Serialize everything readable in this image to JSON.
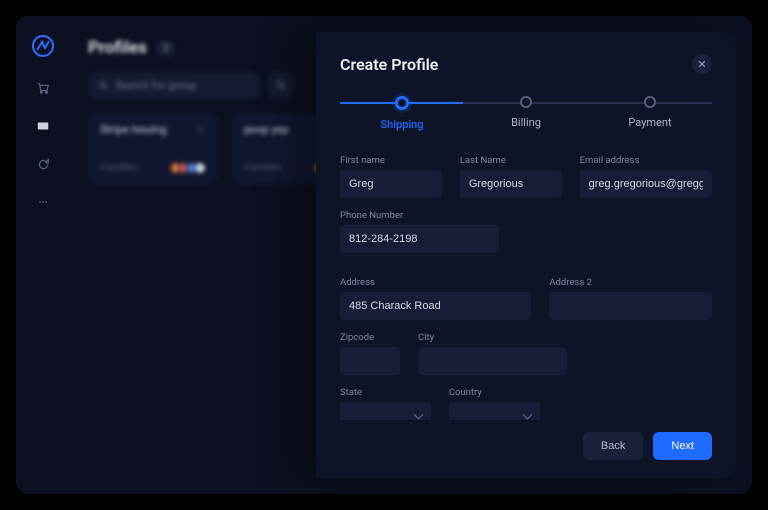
{
  "sidebar": {
    "nav_items": [
      "cart-icon",
      "profiles-icon",
      "refresh-icon",
      "dots-icon"
    ]
  },
  "page": {
    "title": "Profiles",
    "count": "3",
    "search_placeholder": "Search for group"
  },
  "cards": [
    {
      "title": "Stripe Issuing",
      "meta": "4 profiles"
    },
    {
      "title": "poop yep",
      "meta": "4 profiles"
    }
  ],
  "modal": {
    "title": "Create Profile",
    "close_glyph": "✕",
    "steps": [
      {
        "label": "Shipping",
        "active": true
      },
      {
        "label": "Billing",
        "active": false
      },
      {
        "label": "Payment",
        "active": false
      }
    ],
    "fields": {
      "first_name_label": "First name",
      "first_name": "Greg",
      "last_name_label": "Last Name",
      "last_name": "Gregorious",
      "email_label": "Email address",
      "email": "greg.gregorious@gregger.com",
      "phone_label": "Phone Number",
      "phone": "812-284-2198",
      "address_label": "Address",
      "address": "485 Charack Road",
      "address2_label": "Address 2",
      "address2": "",
      "zipcode_label": "Zipcode",
      "zipcode": "",
      "city_label": "City",
      "city": "",
      "state_label": "State",
      "state": "",
      "country_label": "Country",
      "country": ""
    },
    "back_label": "Back",
    "next_label": "Next"
  }
}
